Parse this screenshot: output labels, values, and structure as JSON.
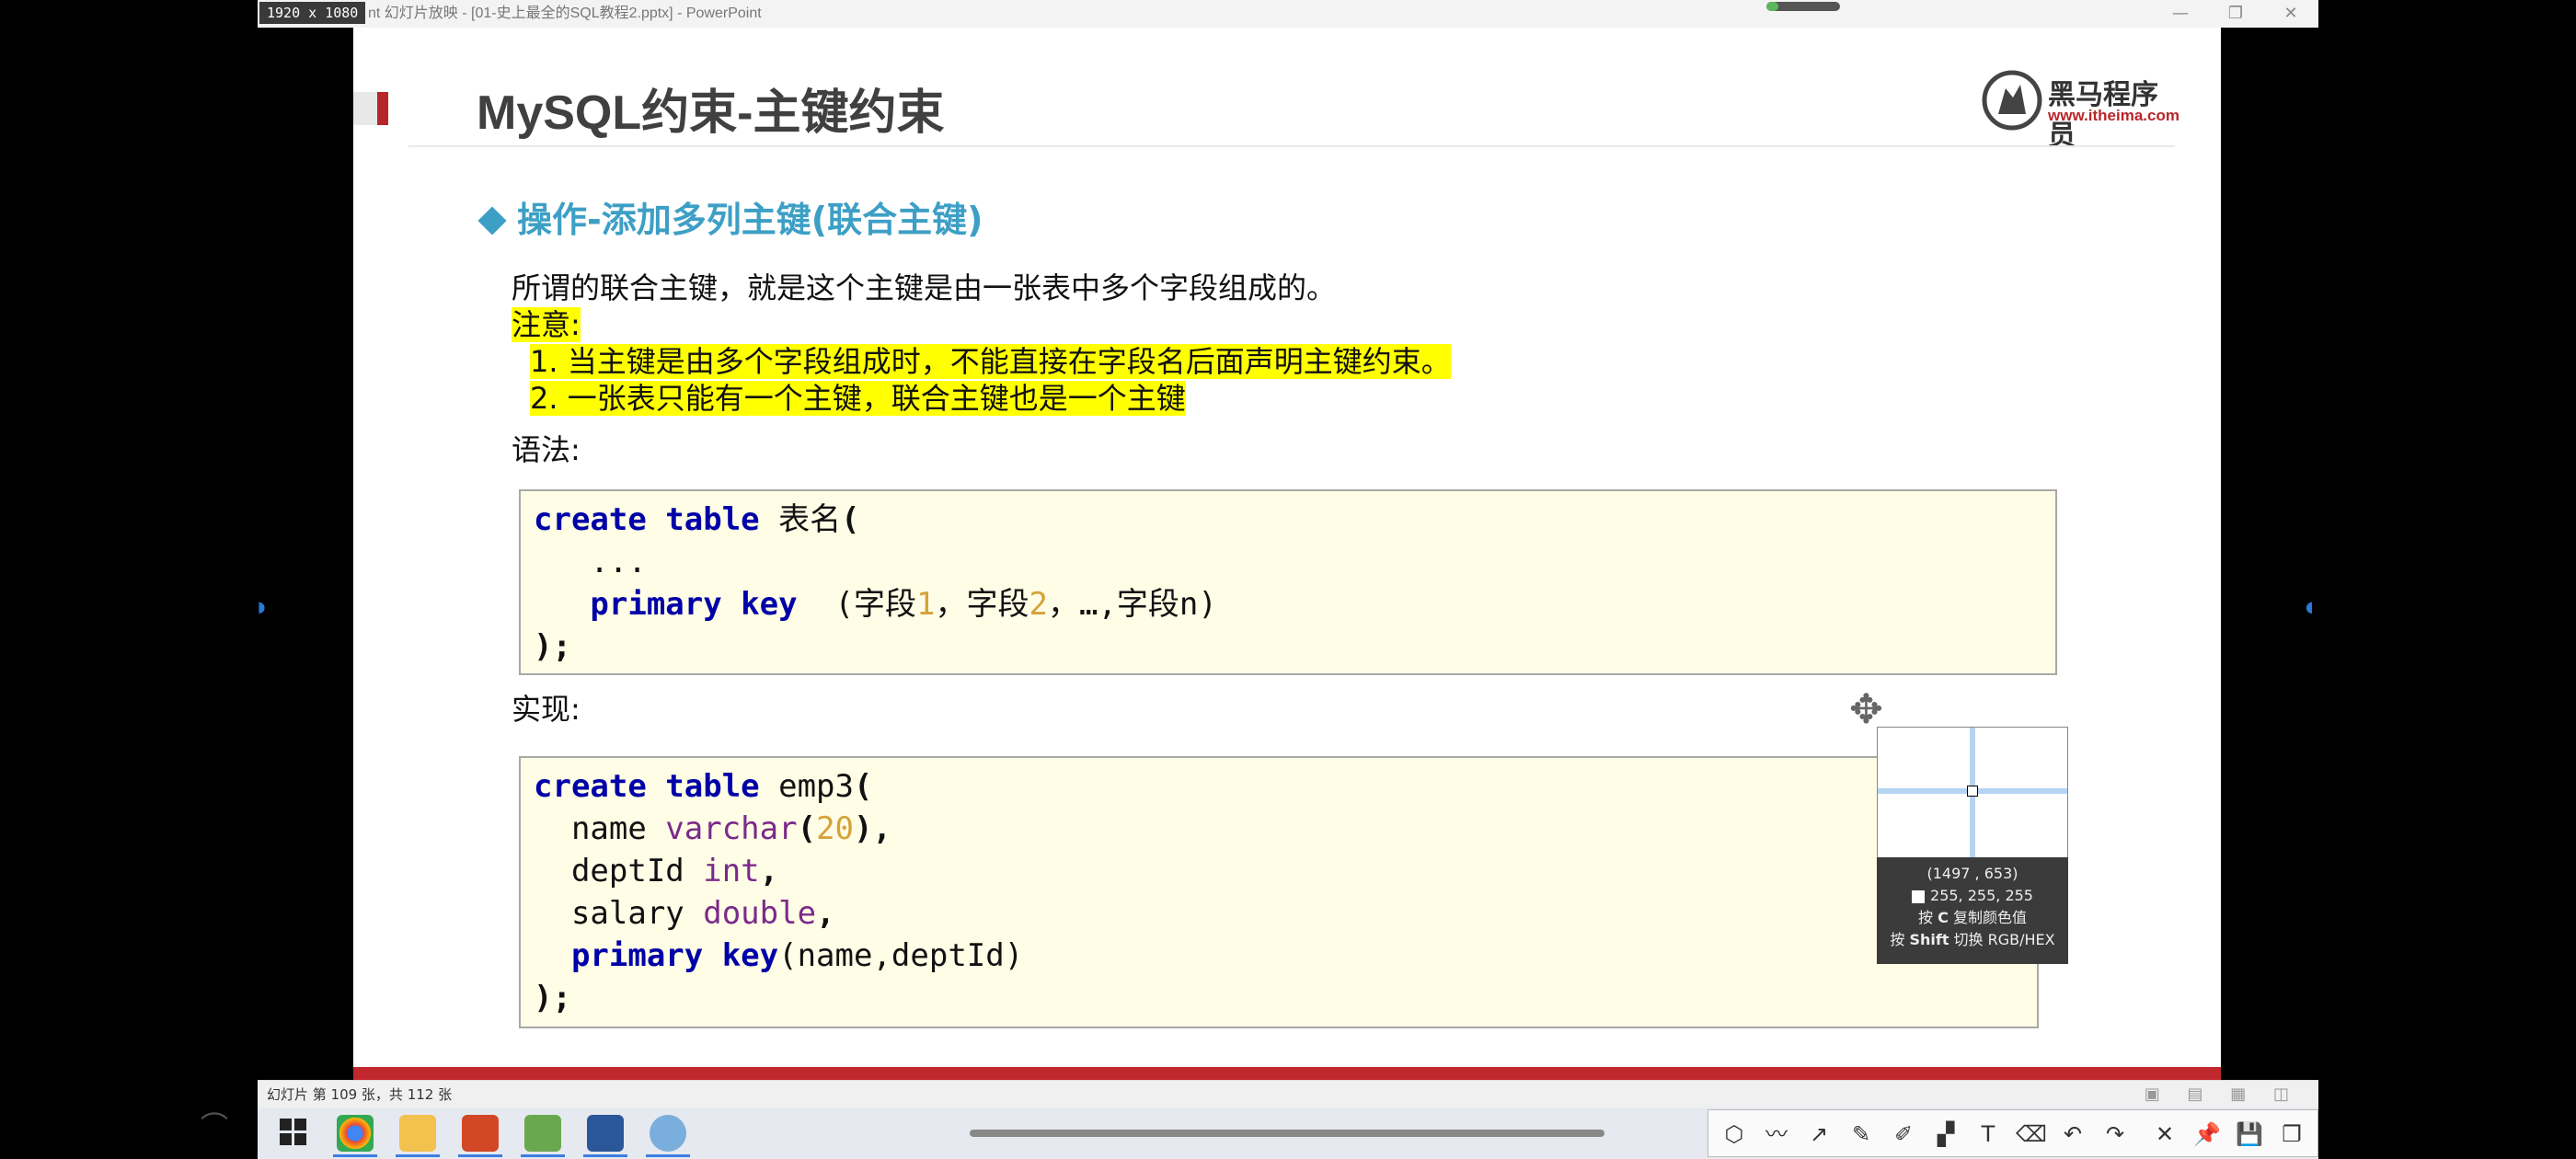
{
  "window": {
    "dims_badge": "1920 x 1080",
    "title": "nt 幻灯片放映 - [01-史上最全的SQL教程2.pptx] - PowerPoint",
    "controls": {
      "minimize": "—",
      "restore": "❐",
      "close": "✕"
    }
  },
  "slide": {
    "title": "MySQL约束-主键约束",
    "logo": {
      "name": "黑马程序员",
      "url": "www.itheima.com"
    },
    "section": "操作-添加多列主键(联合主键)",
    "intro": "所谓的联合主键，就是这个主键是由一张表中多个字段组成的。",
    "note_label": "注意:",
    "notes": [
      "1. 当主键是由多个字段组成时，不能直接在字段名后面声明主键约束。",
      "2. 一张表只能有一个主键，联合主键也是一个主键"
    ],
    "syntax_label": "语法:",
    "syntax_code": {
      "l1_kw": "create table",
      "l1_rest": " 表名",
      "l1_paren": "(",
      "l2": "   ...",
      "l3_kw": "primary key",
      "l3_a": "  (字段",
      "l3_n1": "1",
      "l3_b": "，字段",
      "l3_n2": "2",
      "l3_c": "，…,字段n)",
      "l4": ");"
    },
    "impl_label": "实现:",
    "impl_code": {
      "l1_kw": "create table",
      "l1_rest": " emp3",
      "l1_paren": "(",
      "l2_name": "  name ",
      "l2_type": "varchar",
      "l2_p1": "(",
      "l2_num": "20",
      "l2_p2": "),",
      "l3_name": "  deptId ",
      "l3_type": "int",
      "l3_end": ",",
      "l4_name": "  salary ",
      "l4_type": "double",
      "l4_end": ",",
      "l5_kw": "  primary key",
      "l5_rest": "(name,deptId)",
      "l6": ");"
    }
  },
  "color_picker": {
    "coords": "(1497 , 653)",
    "rgb": "255, 255, 255",
    "hint1_pre": "按 ",
    "hint1_key": "C",
    "hint1_post": " 复制颜色值",
    "hint2_pre": "按 ",
    "hint2_key": "Shift",
    "hint2_post": " 切换 RGB/HEX"
  },
  "statusbar": {
    "text": "幻灯片 第 109 张，共 112 张"
  },
  "colors": {
    "accent_red": "#b8262a",
    "section_blue": "#3d9fc5",
    "highlight": "#ffff00",
    "code_bg": "#fffde6",
    "keyword": "#0000a8"
  },
  "toolbar_icons": [
    "shape-icon",
    "line-icon",
    "arrow-icon",
    "pen-icon",
    "marker-icon",
    "mosaic-icon",
    "text-icon",
    "eraser-icon",
    "undo-icon",
    "redo-icon",
    "close-icon",
    "pin-icon",
    "save-icon",
    "copy-icon"
  ]
}
